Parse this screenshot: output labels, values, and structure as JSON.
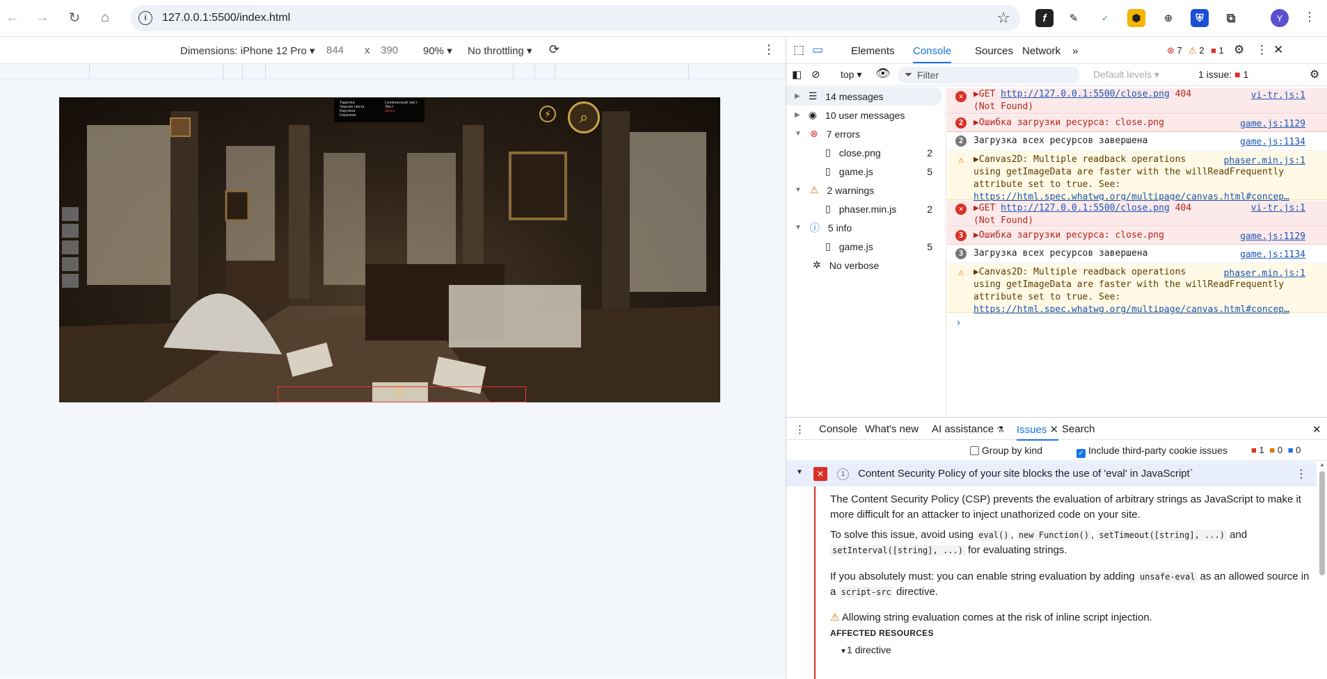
{
  "browser": {
    "url": "127.0.0.1:5500/index.html",
    "avatar_letter": "Y",
    "extensions": [
      "function-icon",
      "eyedropper-icon",
      "abc-checker-icon",
      "honeycomb-icon",
      "robot-icon",
      "shield-icon",
      "puzzle-icon"
    ]
  },
  "device_toolbar": {
    "device": "Dimensions: iPhone 12 Pro",
    "width": "844",
    "times": "x",
    "height": "390",
    "zoom": "90%",
    "throttling": "No throttling"
  },
  "game": {
    "inventory_list": {
      "col1": [
        "Тарелка",
        "Черная свеча",
        "Картина",
        "Сережки"
      ],
      "col2": [
        "Скомканный лист",
        "Лист",
        "Шаль"
      ]
    },
    "bottom_label": "Ищи"
  },
  "devtools": {
    "tabs": [
      "Elements",
      "Console",
      "Sources",
      "Network"
    ],
    "active_tab": "Console",
    "counts": {
      "errors": "7",
      "warnings": "2",
      "issues": "1"
    },
    "context": "top",
    "filter_placeholder": "Filter",
    "levels": "Default levels",
    "issues_summary": "1 issue:",
    "issues_summary_count": "1",
    "sidebar": [
      {
        "label": "14 messages",
        "count": ""
      },
      {
        "label": "10 user messages",
        "count": ""
      },
      {
        "label": "7 errors",
        "count": ""
      },
      {
        "label": "close.png",
        "count": "2"
      },
      {
        "label": "game.js",
        "count": "5"
      },
      {
        "label": "2 warnings",
        "count": ""
      },
      {
        "label": "phaser.min.js",
        "count": "2"
      },
      {
        "label": "5 info",
        "count": ""
      },
      {
        "label": "game.js",
        "count": "5"
      },
      {
        "label": "No verbose",
        "count": ""
      }
    ],
    "messages": [
      {
        "type": "err",
        "line1_pre": "▶GET ",
        "link": "http://127.0.0.1:5500/close.png",
        "line1_post": " 404",
        "line2": "(Not Found)",
        "src": "vi-tr.js:1"
      },
      {
        "type": "err",
        "badge": "2",
        "text": "▶Ошибка загрузки ресурса: close.png",
        "src": "game.js:1129"
      },
      {
        "type": "info",
        "badge": "2",
        "text": "Загрузка всех ресурсов завершена",
        "src": "game.js:1134"
      },
      {
        "type": "warn",
        "line1": "▶Canvas2D: Multiple readback operations",
        "line2": "using getImageData are faster with the willReadFrequently",
        "line3": "attribute set to true. See:",
        "link": "https://html.spec.whatwg.org/multipage/canvas.html#concep…",
        "src": "phaser.min.js:1"
      },
      {
        "type": "err",
        "line1_pre": "▶GET ",
        "link": "http://127.0.0.1:5500/close.png",
        "line1_post": " 404",
        "line2": "(Not Found)",
        "src": "vi-tr.js:1"
      },
      {
        "type": "err",
        "badge": "3",
        "text": "▶Ошибка загрузки ресурса: close.png",
        "src": "game.js:1129"
      },
      {
        "type": "info",
        "badge": "3",
        "text": "Загрузка всех ресурсов завершена",
        "src": "game.js:1134"
      },
      {
        "type": "warn",
        "line1": "▶Canvas2D: Multiple readback operations",
        "line2": "using getImageData are faster with the willReadFrequently",
        "line3": "attribute set to true. See:",
        "link": "https://html.spec.whatwg.org/multipage/canvas.html#concep…",
        "src": "phaser.min.js:1"
      }
    ],
    "prompt": "›"
  },
  "drawer": {
    "tabs": [
      "Console",
      "What's new",
      "AI assistance",
      "Issues",
      "Search"
    ],
    "active_tab": "Issues",
    "group_by_kind": "Group by kind",
    "include_third_party": "Include third-party cookie issues",
    "counts": {
      "errors": "1",
      "warnings": "0",
      "info": "0"
    },
    "issue": {
      "count": "1",
      "title": "Content Security Policy of your site blocks the use of 'eval' in JavaScript`",
      "p1": "The Content Security Policy (CSP) prevents the evaluation of arbitrary strings as JavaScript to make it more difficult for an attacker to inject unathorized code on your site.",
      "p2_pre": "To solve this issue, avoid using",
      "p2_codes": [
        "eval()",
        "new Function()",
        "setTimeout([string], ...)",
        "setInterval([string], ...)"
      ],
      "p2_and": "and",
      "p2_post": "for evaluating strings.",
      "p3_pre": "If you absolutely must: you can enable string evaluation by adding",
      "p3_code1": "unsafe-eval",
      "p3_mid": "as an allowed source in a",
      "p3_code2": "script-src",
      "p3_post": "directive.",
      "warning": "Allowing string evaluation comes at the risk of inline script injection.",
      "affected": "AFFECTED RESOURCES",
      "directive": "1 directive"
    }
  },
  "colors": {
    "error": "#d93025",
    "warning": "#e37400",
    "accent": "#1a73e8"
  }
}
